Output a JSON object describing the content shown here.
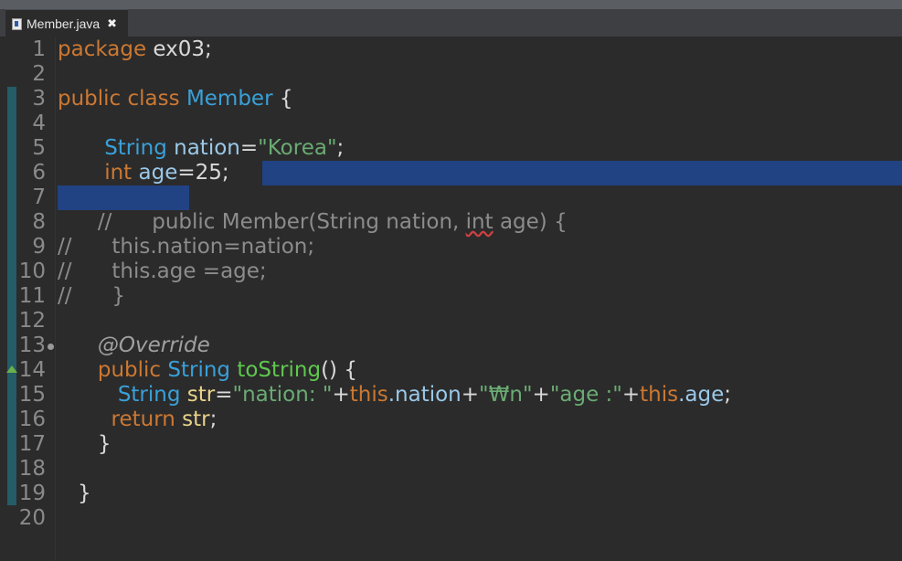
{
  "window": {
    "tab": {
      "label": "Member.java",
      "close_glyph": "✖",
      "icon": "java-file-icon"
    }
  },
  "editor": {
    "line_numbers": [
      "1",
      "2",
      "3",
      "4",
      "5",
      "6",
      "7",
      "8",
      "9",
      "10",
      "11",
      "12",
      "13",
      "14",
      "15",
      "16",
      "17",
      "18",
      "19",
      "20"
    ],
    "lines": {
      "l1": {
        "kw": "package",
        "rest": " ex03;"
      },
      "l3": {
        "kw1": "public",
        "kw2": "class",
        "name": "Member",
        "brace": "{"
      },
      "l5": {
        "type": "String",
        "var": "nation",
        "eq": "=",
        "str": "\"Korea\"",
        "end": ";"
      },
      "l6": {
        "type": "int",
        "var": "age",
        "eq": "=",
        "num": "25",
        "end": ";"
      },
      "l8": {
        "cmt": "//",
        "text": "public Member(String nation, ",
        "squig": "int",
        "tail": " age) {"
      },
      "l9": {
        "cmt": "//",
        "text": "this.nation=nation;"
      },
      "l10": {
        "cmt": "//",
        "text": "this.age =age;"
      },
      "l11": {
        "cmt": "//",
        "text": "}"
      },
      "l13": {
        "ann": "@Override"
      },
      "l14": {
        "kw": "public",
        "type": "String",
        "meth": "toString",
        "rest": "() {"
      },
      "l15": {
        "type": "String",
        "var": "str",
        "eq": "=",
        "s1": "\"nation: \"",
        "p1": "+",
        "this1": "this",
        "f1": ".nation",
        "p2": "+",
        "s2": "\"₩n\"",
        "p3": "+",
        "s3": "\"age :\"",
        "p4": "+",
        "this2": "this",
        "f2": ".age",
        "end": ";"
      },
      "l16": {
        "kw": "return",
        "var": "str",
        "end": ";"
      },
      "l17": {
        "brace": "}"
      },
      "l19": {
        "brace": "}"
      }
    },
    "colors": {
      "background": "#2b2b2b",
      "selection": "#214283",
      "keyword": "#cc7832",
      "type": "#3aa0d8",
      "string": "#6aab73",
      "comment": "#8c8c8c"
    }
  }
}
